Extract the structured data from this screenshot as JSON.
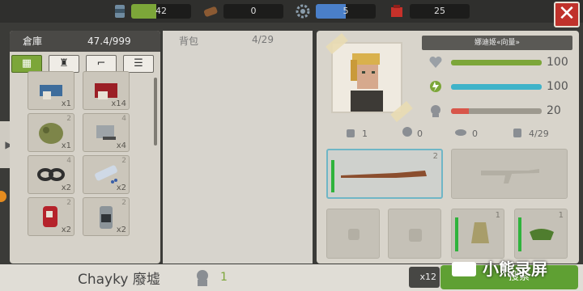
{
  "resources": {
    "food": {
      "value": "42",
      "icon": "food-can-icon",
      "fill": 0.42,
      "color": "#7ca639"
    },
    "wood": {
      "value": "0",
      "icon": "wood-log-icon"
    },
    "parts": {
      "value": "5",
      "icon": "gear-icon",
      "fill": 0.5,
      "color": "#4a7fc9"
    },
    "medicine": {
      "value": "25",
      "icon": "medkit-icon"
    }
  },
  "close_label": "✕",
  "storage": {
    "title": "倉庫",
    "weight": "47.4/999",
    "filters": [
      "all-items-icon",
      "armor-icon",
      "weapon-icon",
      "misc-icon"
    ],
    "items": [
      {
        "icon": "blue-armor-icon",
        "count": "x1",
        "durability": ""
      },
      {
        "icon": "red-box-icon",
        "count": "x14",
        "durability": ""
      },
      {
        "icon": "camo-bag-icon",
        "count": "x1",
        "durability": "2"
      },
      {
        "icon": "tool-box-icon",
        "count": "x4",
        "durability": "4"
      },
      {
        "icon": "goggles-icon",
        "count": "x2",
        "durability": "4"
      },
      {
        "icon": "pills-icon",
        "count": "x2",
        "durability": "2"
      },
      {
        "icon": "blood-bag-icon",
        "count": "x2",
        "durability": "2"
      },
      {
        "icon": "canister-icon",
        "count": "x2",
        "durability": "2"
      }
    ]
  },
  "backpack": {
    "title": "背包",
    "count": "4/29"
  },
  "character": {
    "name": "娜迪姬«向量»",
    "stats": [
      {
        "icon": "heart-icon",
        "value": "100",
        "fill": 1.0,
        "color": "#7ca639"
      },
      {
        "icon": "stamina-icon",
        "value": "100",
        "fill": 1.0,
        "color": "#3fb3c9"
      },
      {
        "icon": "hunger-icon",
        "value": "20",
        "fill": 0.2,
        "color": "#d8564a"
      }
    ],
    "mini": [
      {
        "icon": "armor-stat-icon",
        "value": "1"
      },
      {
        "icon": "skull-stat-icon",
        "value": "0"
      },
      {
        "icon": "eye-stat-icon",
        "value": "0"
      },
      {
        "icon": "bag-stat-icon",
        "value": "4/29"
      }
    ],
    "weapon_durability": "2",
    "item_dur_a": "1",
    "item_dur_b": "1"
  },
  "bottom": {
    "location": "Chayky 廢墟",
    "survivors": "1",
    "stack": "x12",
    "action": "搜索"
  },
  "watermark": "小熊录屏"
}
